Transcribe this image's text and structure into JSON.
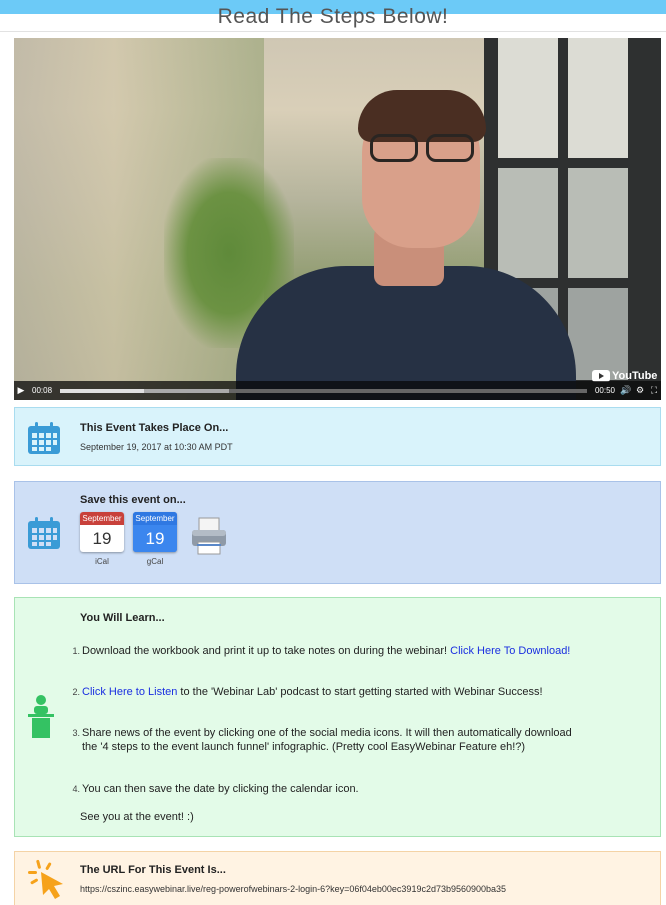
{
  "header": {
    "title": "Read The Steps Below!"
  },
  "video": {
    "current_time": "00:08",
    "duration": "00:50",
    "progress": 0.16,
    "buffered": 0.32,
    "brand": "YouTube",
    "play_icon": "play-icon",
    "volume_icon": "volume-icon",
    "settings_icon": "gear-icon",
    "fullscreen_icon": "fullscreen-icon"
  },
  "event_date": {
    "title": "This Event Takes Place On...",
    "date": "September 19, 2017 at 10:30 AM PDT",
    "icon": "calendar-icon"
  },
  "save_event": {
    "title": "Save this event on...",
    "ical": {
      "month": "September",
      "day": "19",
      "label": "iCal"
    },
    "gcal": {
      "month": "September",
      "day": "19",
      "label": "gCal"
    },
    "print_icon": "printer-icon",
    "colors": {
      "ical": "#c8413b",
      "gcal": "#2f78e2"
    }
  },
  "learn": {
    "title": "You Will Learn...",
    "items": [
      {
        "num": "1.",
        "text": "Download the workbook and print it up to take notes on during the webinar! ",
        "link": "Click Here To Download!"
      },
      {
        "num": "2.",
        "link": "Click Here to Listen",
        "text": " to the 'Webinar Lab' podcast to start getting started with Webinar Success!"
      },
      {
        "num": "3.",
        "text": "Share news of the event by clicking one of the social media icons.  It will then automatically download",
        "text2": "the '4 steps to the event launch funnel' infographic. (Pretty cool EasyWebinar Feature eh!?)"
      },
      {
        "num": "4.",
        "text": "You can then save the date by clicking the calendar icon."
      }
    ],
    "closing": "See you at the event! :)",
    "icon": "speaker-podium-icon"
  },
  "url": {
    "title": "The URL For This Event Is...",
    "value": "https://cszinc.easywebinar.live/reg-powerofwebinars-2-login-6?key=06f04eb00ec3919c2d73b9560900ba35",
    "icon": "cursor-click-icon"
  }
}
